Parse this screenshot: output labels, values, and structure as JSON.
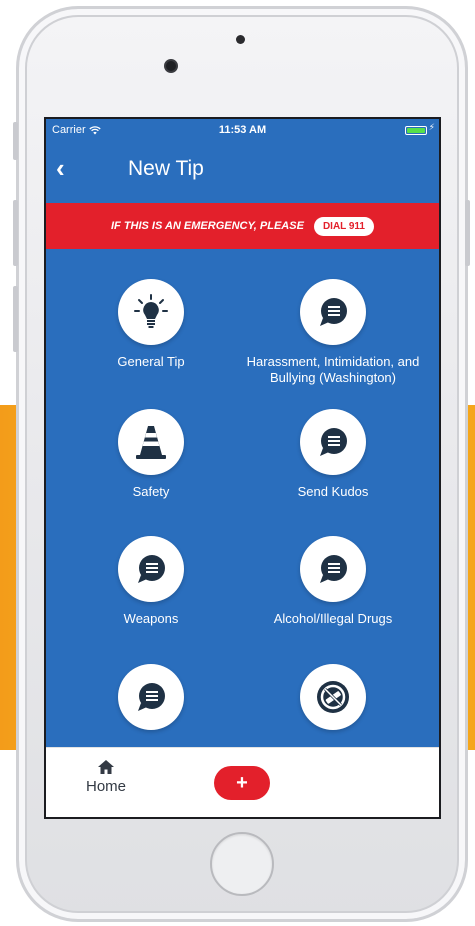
{
  "status_bar": {
    "carrier": "Carrier",
    "time": "11:53 AM"
  },
  "nav": {
    "title": "New Tip",
    "back_icon": "chevron-left-icon"
  },
  "emergency": {
    "text": "IF THIS IS AN EMERGENCY, PLEASE",
    "dial_label": "DIAL 911"
  },
  "categories": [
    {
      "label": "General Tip",
      "icon": "lightbulb-icon"
    },
    {
      "label": "Harassment, Intimidation, and Bullying (Washington)",
      "icon": "chat-bubble-icon"
    },
    {
      "label": "Safety",
      "icon": "traffic-cone-icon"
    },
    {
      "label": "Send Kudos",
      "icon": "chat-bubble-icon"
    },
    {
      "label": "Weapons",
      "icon": "chat-bubble-icon"
    },
    {
      "label": "Alcohol/Illegal Drugs",
      "icon": "chat-bubble-icon"
    },
    {
      "label": "",
      "icon": "chat-bubble-icon"
    },
    {
      "label": "",
      "icon": "no-vape-icon"
    }
  ],
  "tab_bar": {
    "home_label": "Home",
    "add_label": "+"
  },
  "colors": {
    "primary_blue": "#2a6ebd",
    "emergency_red": "#e3202b",
    "icon_navy": "#1f3144",
    "background_yellow": "#f9b81f"
  }
}
